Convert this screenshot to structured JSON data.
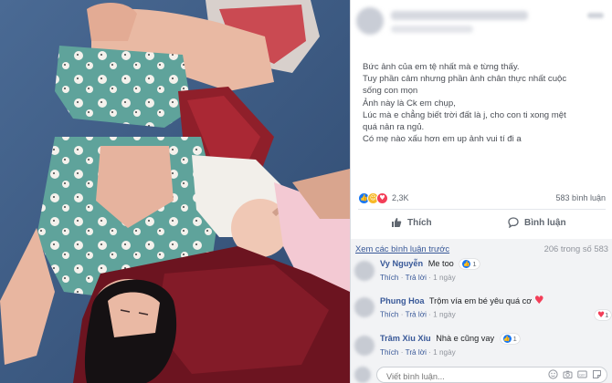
{
  "post": {
    "text_lines": [
      "Bức ảnh của em tệ nhất mà e từng thấy.",
      "Tuy phần cảm nhưng phần ảnh chân thực nhất cuộc",
      "sống con mọn",
      "Ảnh này là Ck em chụp,",
      "Lúc mà e chẳng biết trời đất là j, cho con ti xong mệt",
      "quá nản ra ngủ.",
      "Có mẹ nào xấu hơn em up ảnh vui tí đi a"
    ],
    "reactions": {
      "icons": [
        "like-icon",
        "haha-icon",
        "love-icon"
      ],
      "count": "2,3K"
    },
    "comment_count": "583 bình luận",
    "actions": {
      "like_label": "Thích",
      "comment_label": "Bình luận"
    }
  },
  "comments_section": {
    "view_previous": "Xem các bình luận trước",
    "previous_count": "206 trong số 583",
    "comments": [
      {
        "author": "Vy Nguyễn",
        "text": "Me too",
        "like_label": "Thích",
        "reply_label": "Trả lời",
        "time": "1 ngày",
        "reaction_count": "1",
        "reaction_type": "like"
      },
      {
        "author": "Phung Hoa",
        "text": "Trộm vía em bé yêu quá cơ",
        "like_label": "Thích",
        "reply_label": "Trả lời",
        "time": "1 ngày",
        "reaction_count": "1",
        "reaction_type": "love"
      },
      {
        "author": "Trâm Xiu Xiu",
        "text": "Nhà e cũng vay",
        "like_label": "Thích",
        "reply_label": "Trả lời",
        "time": "1 ngày",
        "reaction_count": "1",
        "reaction_type": "like"
      }
    ],
    "write_placeholder": "Viết bình luận..."
  },
  "colors": {
    "link": "#385898",
    "like": "#1877f2",
    "love": "#f33e58",
    "haha": "#f7b928"
  }
}
